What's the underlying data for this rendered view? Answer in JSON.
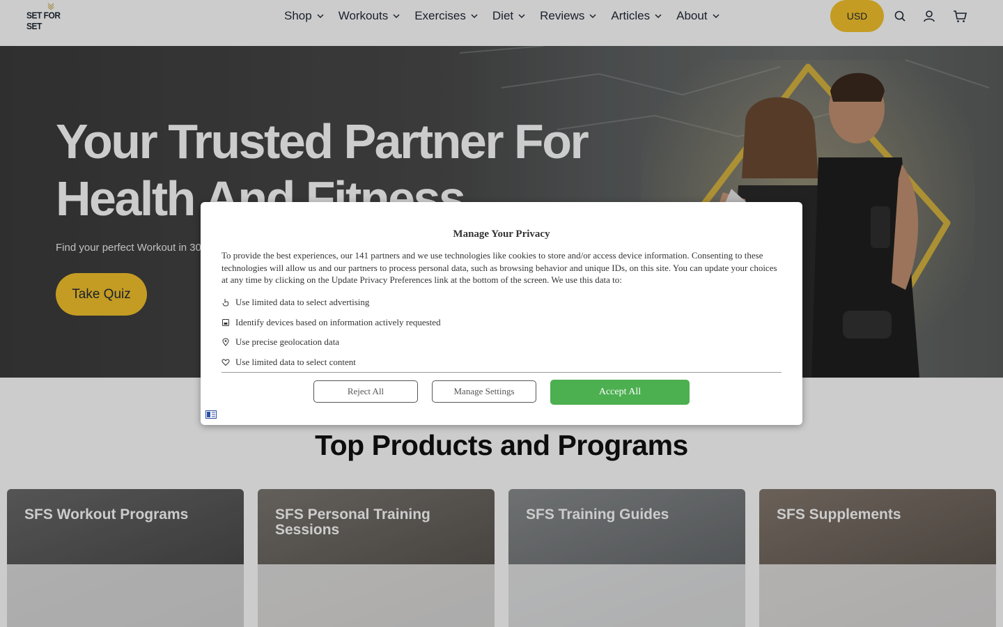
{
  "header": {
    "logo_text": "SET FOR SET",
    "nav": [
      {
        "label": "Shop"
      },
      {
        "label": "Workouts"
      },
      {
        "label": "Exercises"
      },
      {
        "label": "Diet"
      },
      {
        "label": "Reviews"
      },
      {
        "label": "Articles"
      },
      {
        "label": "About"
      }
    ],
    "currency_label": "USD",
    "icons": [
      "search-icon",
      "account-icon",
      "cart-icon"
    ]
  },
  "hero": {
    "title_line1": "Your Trusted Partner For",
    "title_line2": "Health And Fitness",
    "subtitle": "Find your perfect Workout in 30",
    "cta_label": "Take Quiz"
  },
  "section": {
    "title": "Top Products and Programs",
    "cards": [
      {
        "title": "SFS Workout Programs"
      },
      {
        "title": "SFS Personal Training Sessions"
      },
      {
        "title": "SFS Training Guides"
      },
      {
        "title": "SFS Supplements"
      }
    ]
  },
  "privacy_modal": {
    "title": "Manage Your Privacy",
    "body": "To provide the best experiences, our 141 partners and we use technologies like cookies to store and/or access device information. Consenting to these technologies will allow us and our partners to process personal data, such as browsing behavior and unique IDs, on this site. You can update your choices at any time by clicking on the Update Privacy Preferences link at the bottom of the screen. We use this data to:",
    "purposes": [
      {
        "icon": "hand-pointer-icon",
        "label": "Use limited data to select advertising"
      },
      {
        "icon": "device-icon",
        "label": "Identify devices based on information actively requested"
      },
      {
        "icon": "location-pin-icon",
        "label": "Use precise geolocation data"
      },
      {
        "icon": "heart-icon",
        "label": "Use limited data to select content"
      }
    ],
    "reject_label": "Reject All",
    "manage_label": "Manage Settings",
    "accept_label": "Accept All",
    "language_icon": "language-icon"
  },
  "colors": {
    "brand_yellow": "#f6c42c",
    "accept_green": "#4caf50",
    "overlay": "rgba(0,0,0,0.2)"
  }
}
